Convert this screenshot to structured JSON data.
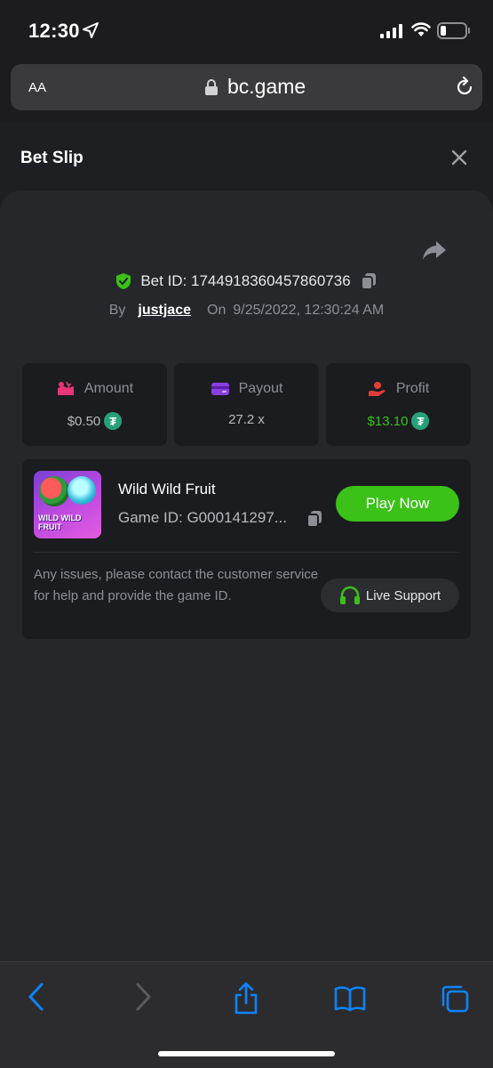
{
  "status_bar": {
    "time": "12:30"
  },
  "browser": {
    "text_size_label": "AA",
    "url": "bc.game"
  },
  "page": {
    "title": "Bet Slip",
    "bet_id_label": "Bet ID: 1744918360457860736",
    "by_label": "By",
    "username": "justjace",
    "on_label": "On",
    "datetime": "9/25/2022, 12:30:24 AM"
  },
  "stats": [
    {
      "label": "Amount",
      "value": "$0.50",
      "currency_icon": "tether-icon"
    },
    {
      "label": "Payout",
      "value": "27.2 x"
    },
    {
      "label": "Profit",
      "value": "$13.10",
      "currency_icon": "tether-icon"
    }
  ],
  "game": {
    "thumb_text": "WILD WILD FRUIT",
    "name": "Wild Wild Fruit",
    "game_id": "Game ID: G000141297...",
    "play_label": "Play Now",
    "issue_text": "Any issues, please contact the customer service for help and provide the game ID.",
    "support_label": "Live Support"
  },
  "colors": {
    "accent_green": "#3bc117",
    "profit_green": "#3bc117",
    "tether_green": "#26a17b",
    "shield_green": "#3bc117",
    "payout_purple": "#8b3fe0",
    "amount_pink": "#e8357a",
    "profit_red": "#e23b3b",
    "ios_blue": "#0a84ff"
  }
}
